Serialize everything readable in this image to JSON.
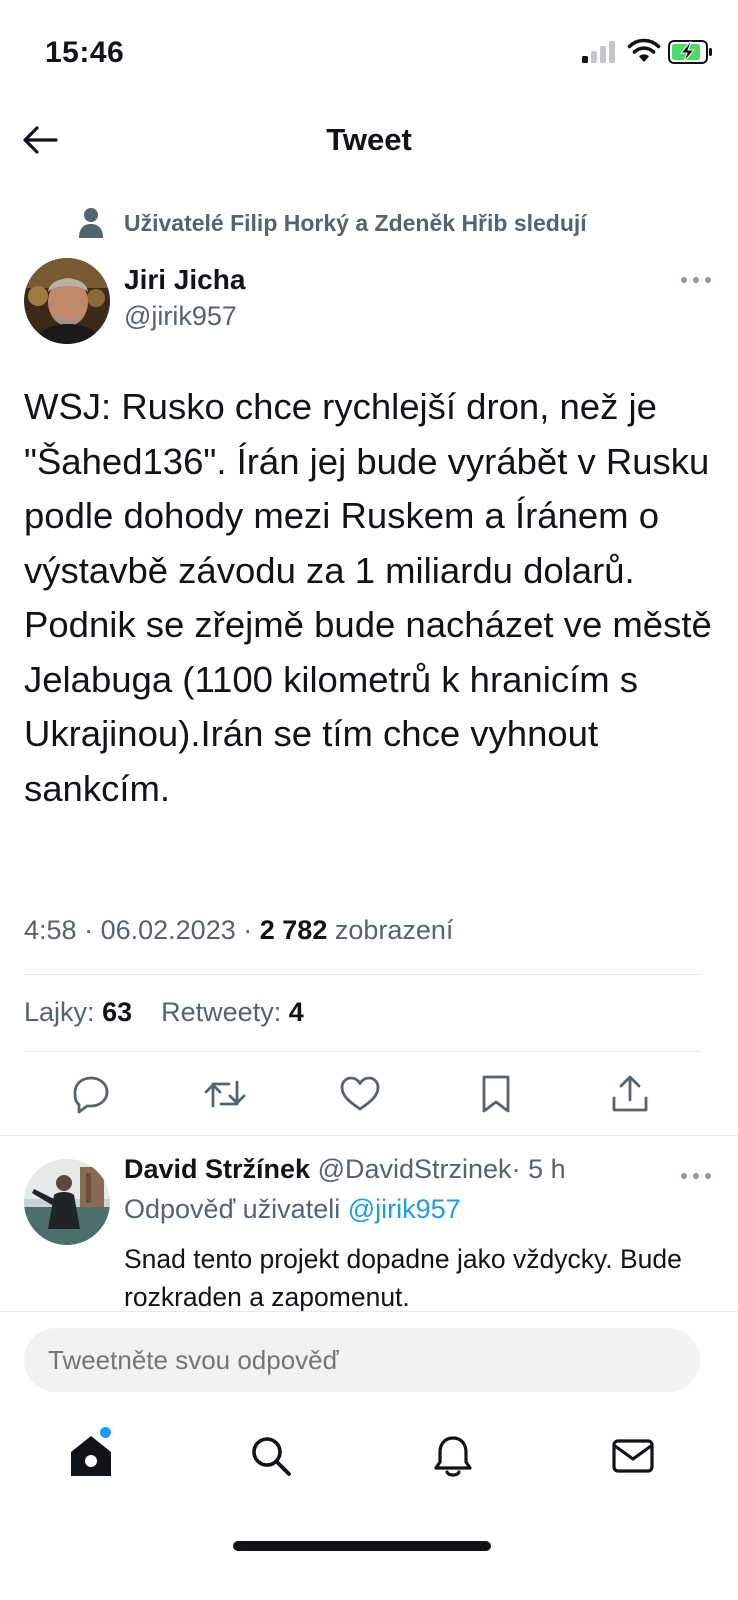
{
  "status_bar": {
    "time": "15:46"
  },
  "header": {
    "title": "Tweet"
  },
  "social_context": {
    "text": "Uživatelé Filip Horký a Zdeněk Hřib sledují"
  },
  "author": {
    "name": "Jiri Jicha",
    "handle": "@jirik957"
  },
  "tweet": {
    "text": "WSJ: Rusko chce rychlejší dron, než je \"Šahed136\".  Írán jej bude  vyrábět v Rusku podle dohody mezi Ruskem a Íránem o výstavbě závodu za 1 miliardu dolarů. Podnik se zřejmě bude nacházet ve městě Jelabuga (1100 kilometrů k hranicím s Ukrajinou).Irán se tím chce vyhnout sankcím.",
    "time": "4:58",
    "separator": "·",
    "date": "06.02.2023",
    "views_count": "2 782",
    "views_label": "zobrazení"
  },
  "stats": {
    "likes_label": "Lajky:",
    "likes_count": "63",
    "retweets_label": "Retweety:",
    "retweets_count": "4"
  },
  "actions": [
    "reply-icon",
    "retweet-icon",
    "like-icon",
    "bookmark-icon",
    "share-icon"
  ],
  "reply": {
    "name": "David Stržínek",
    "handle": "@DavidStrzinek",
    "separator": "·",
    "age": "5 h",
    "replying_label": "Odpověď uživateli",
    "replying_to": "@jirik957",
    "text": "Snad tento projekt dopadne jako vždycky. Bude rozkraden a zapomenut."
  },
  "compose": {
    "placeholder": "Tweetněte svou odpověď"
  },
  "tab_bar": [
    "home-icon",
    "search-icon",
    "notifications-icon",
    "messages-icon"
  ],
  "colors": {
    "accent": "#1d9bf0",
    "text_primary": "#0f1419",
    "text_secondary": "#536471",
    "battery_green": "#4cd964",
    "input_bg": "#eff3f4"
  }
}
